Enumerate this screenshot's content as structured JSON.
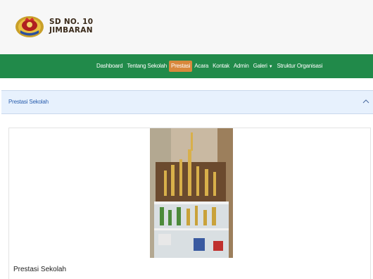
{
  "header": {
    "brand_line1": "SD NO. 10",
    "brand_line2": "JIMBARAN"
  },
  "nav": {
    "items": [
      {
        "label": "Dashboard"
      },
      {
        "label": "Tentang Sekolah"
      },
      {
        "label": "Prestasi"
      },
      {
        "label": "Acara"
      },
      {
        "label": "Kontak"
      },
      {
        "label": "Admin"
      },
      {
        "label": "Galeri"
      },
      {
        "label": "Struktur Organisasi"
      }
    ],
    "active": "Prestasi"
  },
  "accordion": {
    "title": "Prestasi Sekolah",
    "expanded": true
  },
  "content": {
    "image_subject": "trophy cabinet photo",
    "caption": "Prestasi Sekolah"
  },
  "colors": {
    "navbar": "#218a4a",
    "active_nav": "#d8883c",
    "accordion_bg": "#e7f1fd",
    "accordion_text": "#2b5fae"
  }
}
